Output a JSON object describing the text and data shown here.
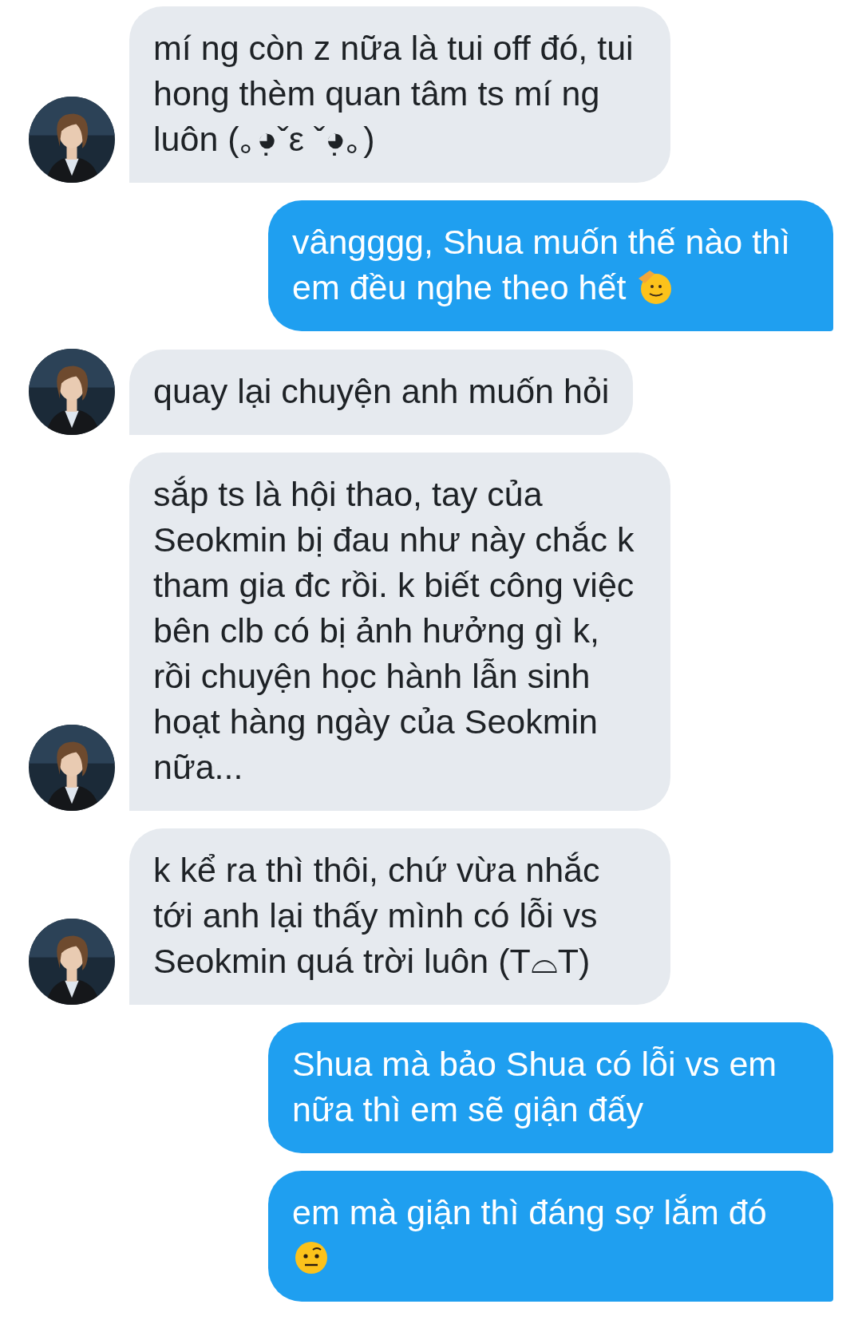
{
  "messages": [
    {
      "kind": "incoming",
      "text": "mí ng còn z nữa là tui off đó, tui hong thèm quan tâm ts mí ng luôn (｡◕̣ˇε ˇ◕̣｡)"
    },
    {
      "kind": "outgoing",
      "text": "vângggg, Shua muốn thế nào thì em đều nghe theo hết",
      "emoji_icon": {
        "kind": "salute"
      }
    },
    {
      "kind": "incoming",
      "text": "quay lại chuyện anh muốn hỏi"
    },
    {
      "kind": "incoming",
      "text": "sắp ts là hội thao, tay của Seokmin bị đau như này chắc k tham gia đc rồi. k biết công việc bên clb có bị ảnh hưởng gì k, rồi chuyện học hành lẫn sinh hoạt hàng ngày của Seokmin nữa..."
    },
    {
      "kind": "incoming",
      "text": "k kể ra thì thôi, chứ vừa nhắc tới anh lại thấy mình có lỗi vs Seokmin quá trời luôn (T⌓T)"
    },
    {
      "kind": "outgoing",
      "text": "Shua mà bảo Shua có lỗi vs em nữa thì em sẽ giận đấy"
    },
    {
      "kind": "outgoing",
      "text": "em mà giận thì đáng sợ lắm đó",
      "emoji_icon": {
        "kind": "eyebrow"
      }
    }
  ]
}
